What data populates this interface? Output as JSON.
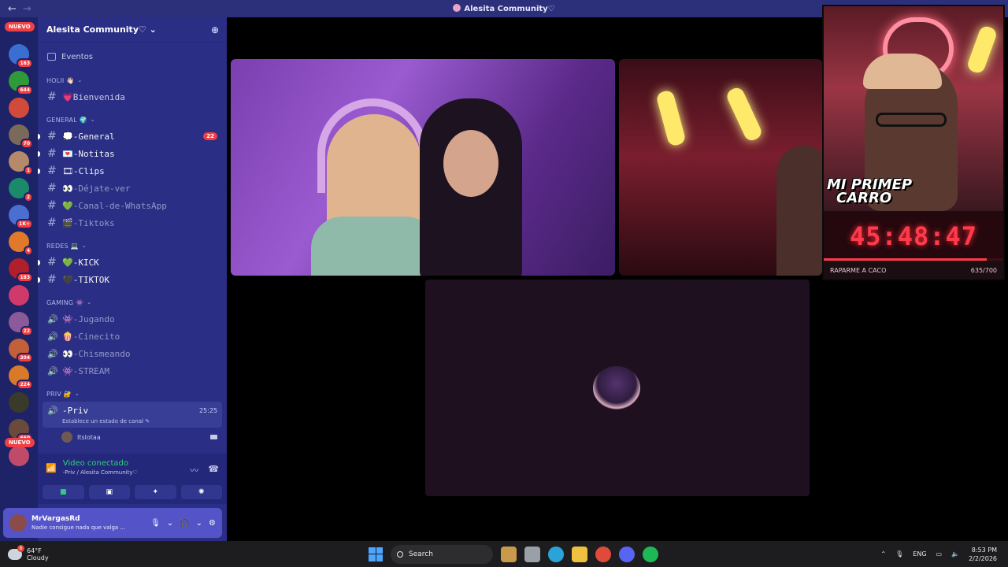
{
  "window": {
    "title": "Alesita Community♡",
    "back": "←",
    "forward": "→"
  },
  "rail": {
    "new_top": "NUEVO",
    "new_bottom": "NUEVO",
    "servers": [
      {
        "badge": "163",
        "color": "#3a6fd1"
      },
      {
        "badge": "644",
        "color": "#2f9a3a"
      },
      {
        "badge": "",
        "color": "#d24a3a"
      },
      {
        "badge": "70",
        "color": "#7a6a5a"
      },
      {
        "badge": "1",
        "color": "#b48a6a"
      },
      {
        "badge": "2",
        "color": "#1a8a6a"
      },
      {
        "badge": "1K+",
        "color": "#4a6fd1"
      },
      {
        "badge": "4",
        "color": "#e07a2a"
      },
      {
        "badge": "183",
        "color": "#b0202a"
      },
      {
        "badge": "",
        "color": "#d03a6a"
      },
      {
        "badge": "22",
        "color": "#8a5a9a"
      },
      {
        "badge": "204",
        "color": "#c2603a"
      },
      {
        "badge": "224",
        "color": "#d87a2a"
      },
      {
        "badge": "",
        "color": "#3a3a2a"
      },
      {
        "badge": "660",
        "color": "#6a4a3a"
      },
      {
        "badge": "",
        "color": "#c04a6a"
      }
    ]
  },
  "sidebar": {
    "guild_name": "Alesita Community♡ ⌄",
    "events": "Eventos",
    "categories": {
      "holii": "HOLII 👋🏻",
      "general": "GENERAL 🌍",
      "redes": "REDES 💻",
      "gaming": "GAMING 👾",
      "priv": "PRIV 🔐"
    },
    "channels": {
      "bienvenida": "💗Bienvenida",
      "general": "💭-General",
      "general_count": "22",
      "notitas": "💌-Notitas",
      "clips": "🎞-Clips",
      "dejate": "👀-Déjate-ver",
      "whatsapp": "💚-Canal-de-WhatsApp",
      "tiktoks": "🎬-Tiktoks",
      "kick": "💚-KICK",
      "tiktok": "🖤-TIKTOK",
      "jugando": "👾-Jugando",
      "cinecito": "🍿-Cinecito",
      "chismeando": "👀-Chismeando",
      "stream": "👾-STREAM",
      "priv": "-Priv",
      "priv_time": "25:25",
      "priv_status": "Establece un estado de canal ✎",
      "member": "Itslotaa"
    }
  },
  "voice": {
    "status": "Video conectado",
    "location": "-Priv / Alesita Community♡"
  },
  "user": {
    "name": "MrVargasRd",
    "status": "Nadie consigue nada que valga ..."
  },
  "overlay": {
    "banner_line1": "MI PRIMEP",
    "banner_line2": "CARRO",
    "timer": "45:48:47",
    "goal_label": "RAPARME A CACO",
    "goal_count": "635/700",
    "goal_progress": 0.907
  },
  "taskbar": {
    "temp": "64°F",
    "condition": "Cloudy",
    "weather_badge": "6",
    "search": "Search",
    "lang": "ENG",
    "time": "8:53 PM",
    "date": "2/2/2026"
  }
}
